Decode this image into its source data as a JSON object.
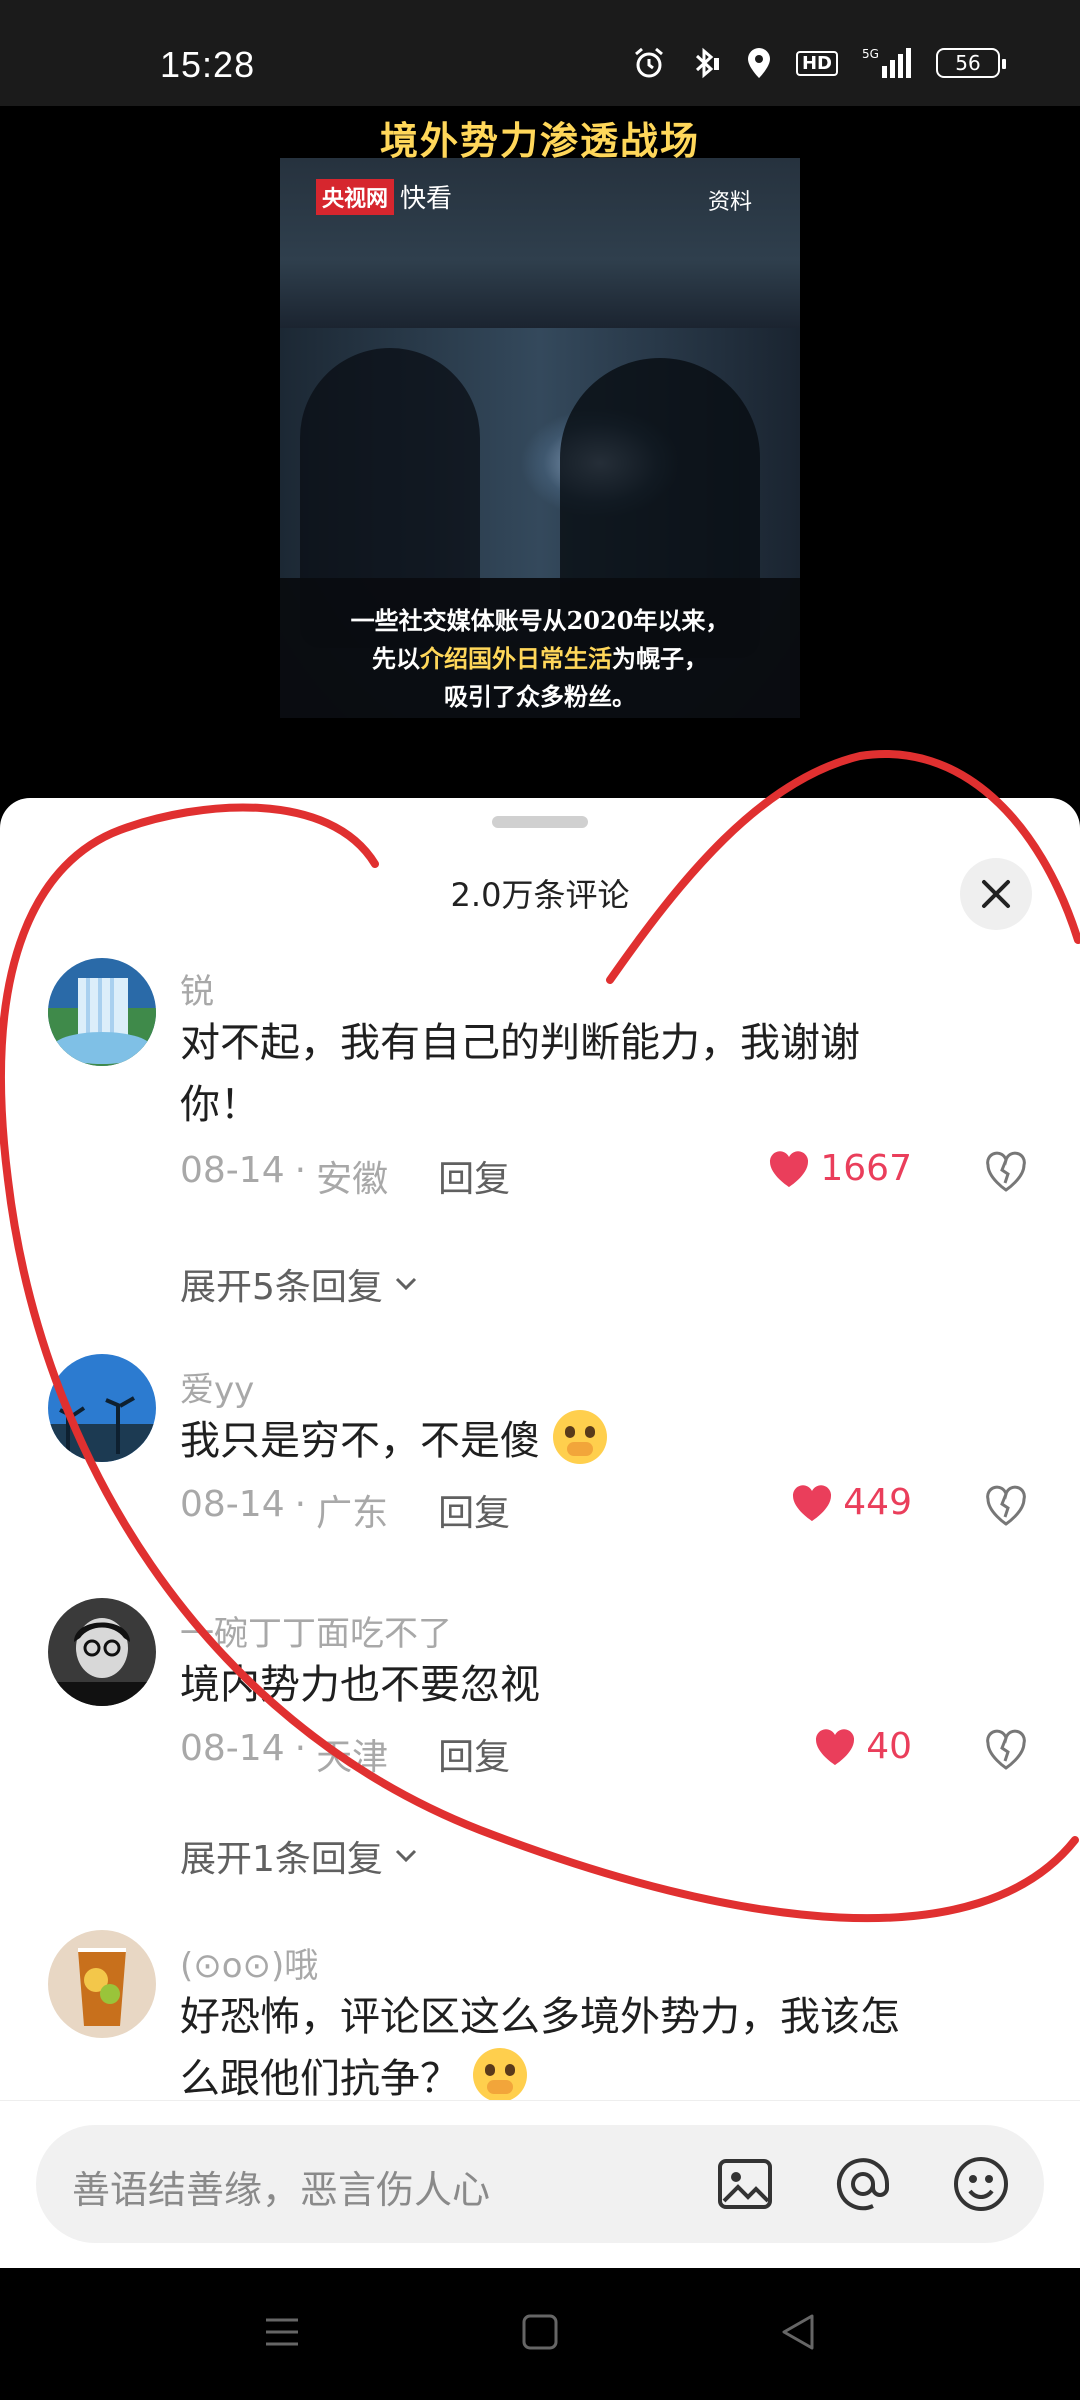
{
  "status": {
    "time": "15:28",
    "network": "5G",
    "hd": "HD",
    "battery": "56"
  },
  "video": {
    "title": "境外势力渗透战场",
    "logo_red": "央视网",
    "logo_text": "快看",
    "tag": "资料",
    "subtitle_line1": "一些社交媒体账号从2020年以来，",
    "subtitle_line2_pre": "先以",
    "subtitle_line2_hl": "介绍国外日常生活",
    "subtitle_line2_post": "为幌子，",
    "subtitle_line3": "吸引了众多粉丝。"
  },
  "sheet": {
    "title": "2.0万条评论"
  },
  "comments": [
    {
      "user": "锐",
      "text_line1": "对不起，我有自己的判断能力，我谢谢",
      "text_line2": "你！",
      "date": "08-14",
      "location": "安徽",
      "reply": "回复",
      "likes": "1667",
      "expand": "展开5条回复"
    },
    {
      "user": "爱yy",
      "text": "我只是穷不，不是傻",
      "date": "08-14",
      "location": "广东",
      "reply": "回复",
      "likes": "449"
    },
    {
      "user": "一碗丁丁面吃不了",
      "text": "境内势力也不要忽视",
      "date": "08-14",
      "location": "天津",
      "reply": "回复",
      "likes": "40",
      "expand": "展开1条回复"
    },
    {
      "user": "(⊙o⊙)哦",
      "text_line1": "好恐怖，评论区这么多境外势力，我该怎",
      "text_line2": "么跟他们抗争？"
    }
  ],
  "input": {
    "placeholder": "善语结善缘，恶言伤人心"
  },
  "colors": {
    "accent": "#ea3e5b",
    "annotation": "#e03030"
  }
}
